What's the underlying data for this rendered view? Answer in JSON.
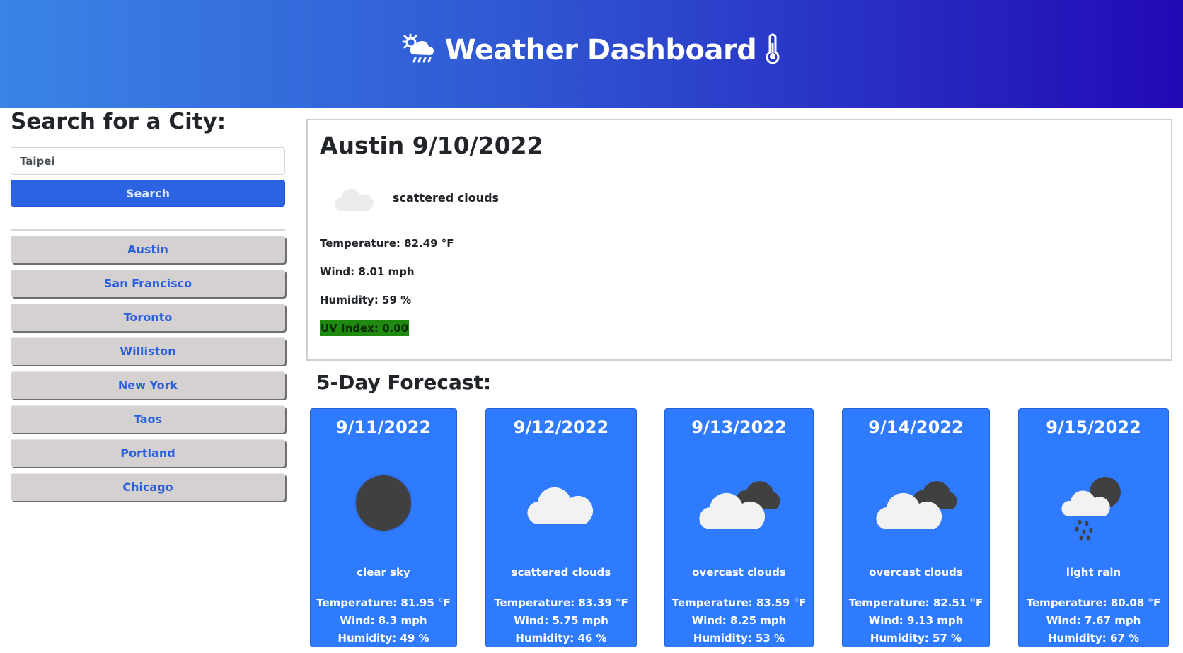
{
  "header": {
    "title": "Weather Dashboard",
    "left_icon": "cloud-sun-rain-icon",
    "right_icon": "thermometer-icon"
  },
  "search": {
    "heading": "Search for a City:",
    "input_value": "Taipei",
    "button_label": "Search"
  },
  "history": [
    "Austin",
    "San Francisco",
    "Toronto",
    "Williston",
    "New York",
    "Taos",
    "Portland",
    "Chicago"
  ],
  "current": {
    "title": "Austin 9/10/2022",
    "description": "scattered clouds",
    "icon": "scattered-clouds-icon",
    "temperature": "Temperature: 82.49 °F",
    "wind": "Wind: 8.01 mph",
    "humidity": "Humidity: 59 %",
    "uv_index": "UV Index: 0.00"
  },
  "forecast": {
    "heading": "5-Day Forecast:",
    "days": [
      {
        "date": "9/11/2022",
        "icon": "clear-sky-icon",
        "description": "clear sky",
        "temperature": "Temperature: 81.95 °F",
        "wind": "Wind: 8.3 mph",
        "humidity": "Humidity: 49 %"
      },
      {
        "date": "9/12/2022",
        "icon": "scattered-clouds-icon",
        "description": "scattered clouds",
        "temperature": "Temperature: 83.39 °F",
        "wind": "Wind: 5.75 mph",
        "humidity": "Humidity: 46 %"
      },
      {
        "date": "9/13/2022",
        "icon": "overcast-clouds-icon",
        "description": "overcast clouds",
        "temperature": "Temperature: 83.59 °F",
        "wind": "Wind: 8.25 mph",
        "humidity": "Humidity: 53 %"
      },
      {
        "date": "9/14/2022",
        "icon": "overcast-clouds-icon",
        "description": "overcast clouds",
        "temperature": "Temperature: 82.51 °F",
        "wind": "Wind: 9.13 mph",
        "humidity": "Humidity: 57 %"
      },
      {
        "date": "9/15/2022",
        "icon": "light-rain-icon",
        "description": "light rain",
        "temperature": "Temperature: 80.08 °F",
        "wind": "Wind: 7.67 mph",
        "humidity": "Humidity: 67 %"
      }
    ]
  },
  "colors": {
    "header_start": "#3a84e6",
    "header_end": "#2209b5",
    "forecast_card": "#2f7bff",
    "search_button": "#2c63e2",
    "uv_low": "#1f8a10"
  }
}
